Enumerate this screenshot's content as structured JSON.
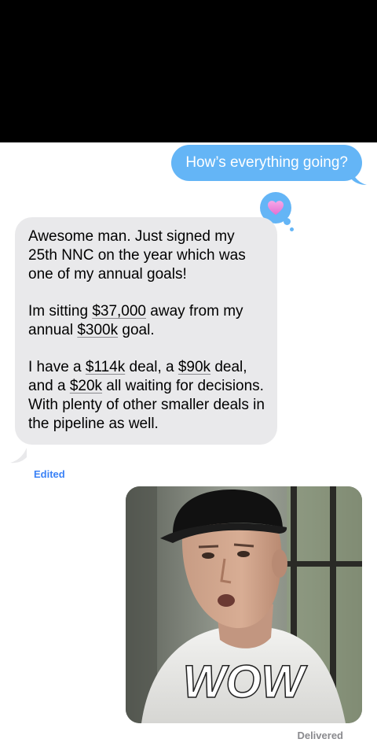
{
  "messages": {
    "outgoing_text": "How’s everything going?",
    "tapback": "heart",
    "incoming": {
      "line1": "Awesome man. Just signed my 25th NNC on the year which was one of my annual goals!",
      "p2_a": "Im sitting ",
      "p2_amt1": "$37,000",
      "p2_b": " away from my annual ",
      "p2_amt2": "$300k",
      "p2_c": " goal.",
      "p3_a": "I have a ",
      "p3_amt1": "$114k",
      "p3_b": " deal, a ",
      "p3_amt2": "$90k",
      "p3_c": " deal, and a ",
      "p3_amt3": "$20k",
      "p3_d": " all waiting for decisions. With plenty of other smaller deals in the pipeline as well."
    },
    "edited_label": "Edited",
    "gif_caption": "WOW",
    "delivered_label": "Delivered"
  },
  "colors": {
    "outgoing_bubble": "#64b5f6",
    "incoming_bubble": "#e9e9eb",
    "edited_text": "#3b82f6",
    "meta_text": "#8a8a8e"
  },
  "icons": {
    "tapback": "heart-icon"
  }
}
